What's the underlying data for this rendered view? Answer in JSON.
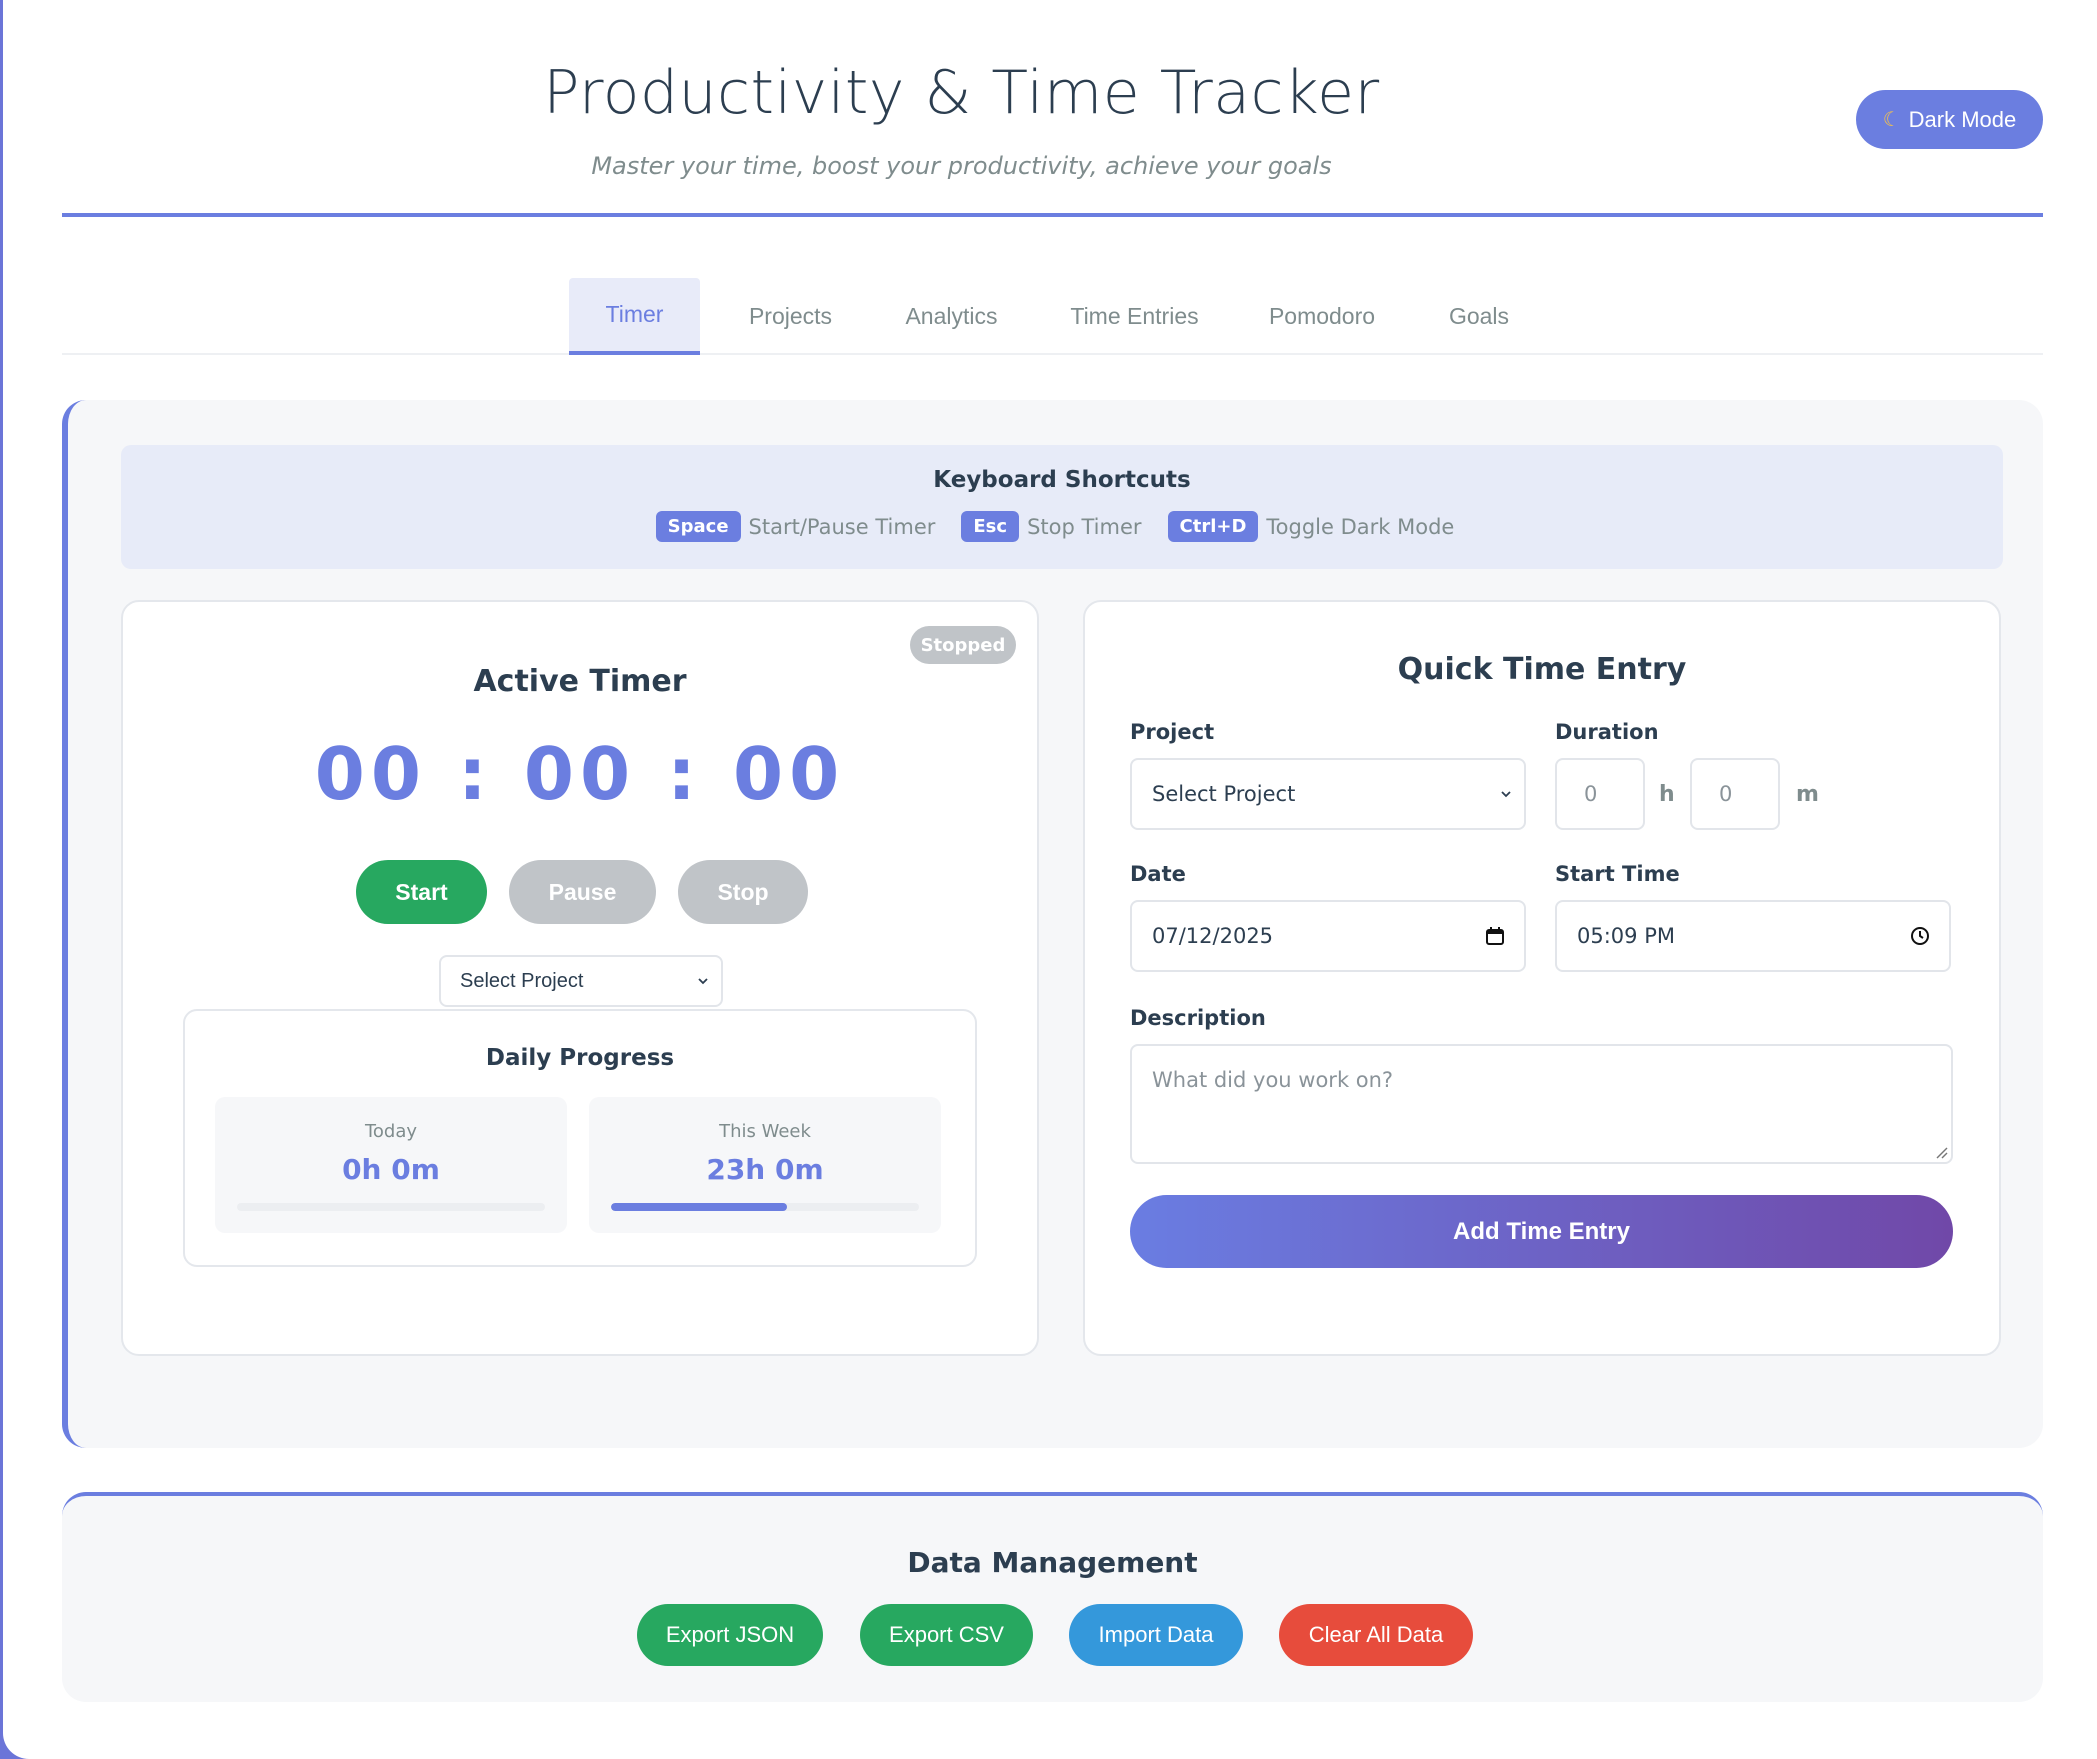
{
  "header": {
    "title": "Productivity & Time Tracker",
    "subtitle": "Master your time, boost your productivity, achieve your goals",
    "dark_mode_label": "Dark Mode",
    "dark_mode_icon": "moon-icon"
  },
  "tabs": [
    {
      "label": "Timer",
      "active": true
    },
    {
      "label": "Projects",
      "active": false
    },
    {
      "label": "Analytics",
      "active": false
    },
    {
      "label": "Time Entries",
      "active": false
    },
    {
      "label": "Pomodoro",
      "active": false
    },
    {
      "label": "Goals",
      "active": false
    }
  ],
  "shortcuts": {
    "title": "Keyboard Shortcuts",
    "items": [
      {
        "key": "Space",
        "action": "Start/Pause Timer"
      },
      {
        "key": "Esc",
        "action": "Stop Timer"
      },
      {
        "key": "Ctrl+D",
        "action": "Toggle Dark Mode"
      }
    ]
  },
  "timer": {
    "status": "Stopped",
    "title": "Active Timer",
    "display": "00:00:00",
    "start_label": "Start",
    "pause_label": "Pause",
    "stop_label": "Stop",
    "project_select": "Select Project"
  },
  "progress": {
    "title": "Daily Progress",
    "today_label": "Today",
    "today_value": "0h 0m",
    "today_fraction": 0,
    "week_label": "This Week",
    "week_value": "23h 0m",
    "week_fraction": 0.57
  },
  "entry": {
    "title": "Quick Time Entry",
    "project_label": "Project",
    "project_value": "Select Project",
    "duration_label": "Duration",
    "hours_placeholder": "0",
    "hours_unit": "h",
    "minutes_placeholder": "0",
    "minutes_unit": "m",
    "date_label": "Date",
    "date_value": "07/12/2025",
    "start_time_label": "Start Time",
    "start_time_value": "05:09 PM",
    "description_label": "Description",
    "description_placeholder": "What did you work on?",
    "add_label": "Add Time Entry"
  },
  "data_management": {
    "title": "Data Management",
    "buttons": [
      {
        "label": "Export JSON",
        "color": "#27a860"
      },
      {
        "label": "Export CSV",
        "color": "#27a860"
      },
      {
        "label": "Import Data",
        "color": "#3498db"
      },
      {
        "label": "Clear All Data",
        "color": "#e74c3c"
      }
    ]
  },
  "colors": {
    "accent": "#6b7ee0",
    "success": "#27a860",
    "info": "#3498db",
    "danger": "#e74c3c",
    "muted": "#c0c4c8"
  }
}
